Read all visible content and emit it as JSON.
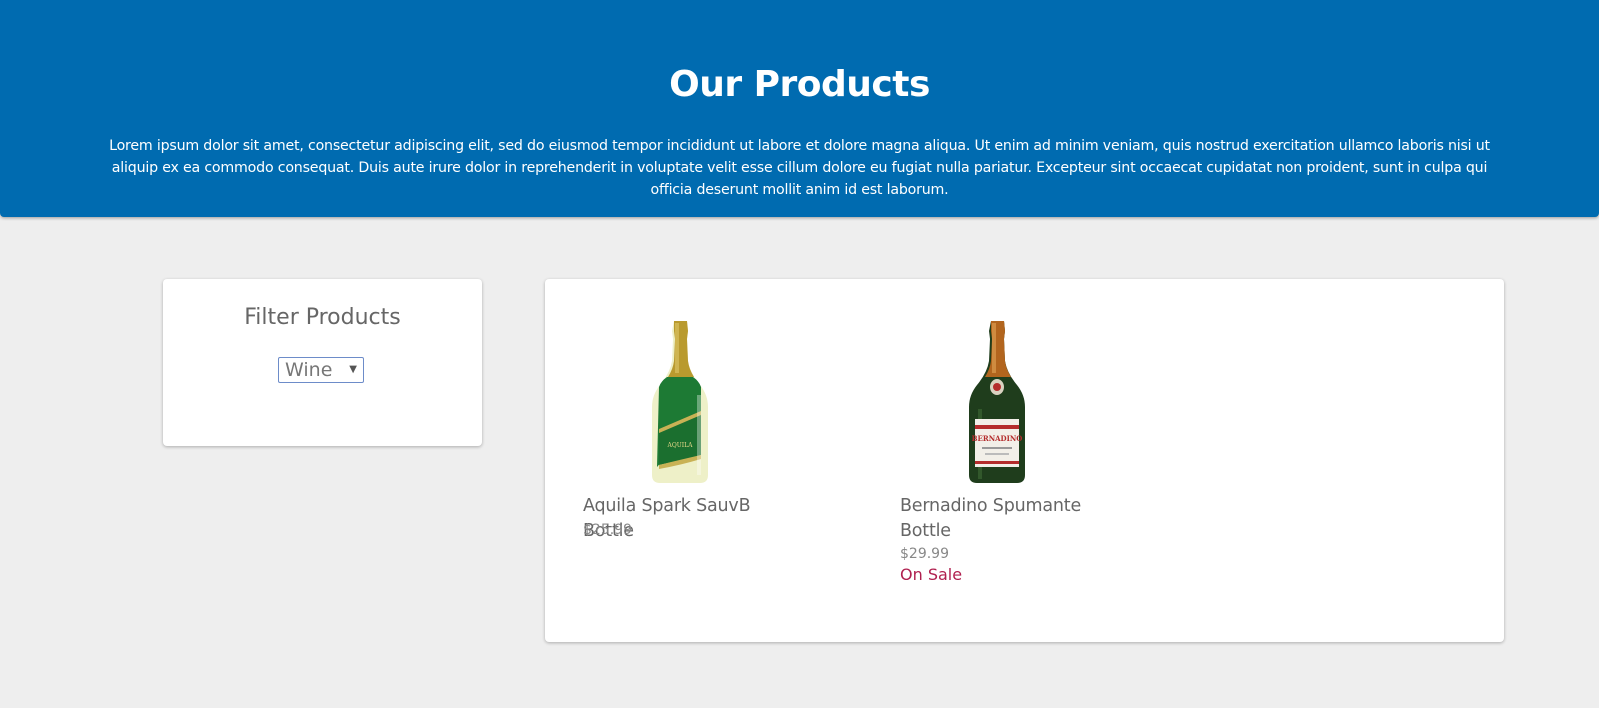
{
  "header": {
    "title": "Our Products",
    "description": "Lorem ipsum dolor sit amet, consectetur adipiscing elit, sed do eiusmod tempor incididunt ut labore et dolore magna aliqua. Ut enim ad minim veniam, quis nostrud exercitation ullamco laboris nisi ut aliquip ex ea commodo consequat. Duis aute irure dolor in reprehenderit in voluptate velit esse cillum dolore eu fugiat nulla pariatur. Excepteur sint occaecat cupidatat non proident, sunt in culpa qui officia deserunt mollit anim id est laborum."
  },
  "filter": {
    "title": "Filter Products",
    "selected": "Wine",
    "caret": "▼"
  },
  "products": [
    {
      "name": "Aquila Spark SauvB Bottle",
      "price": "$25.99",
      "on_sale": "",
      "image_icon": "wine-bottle-aquila-icon"
    },
    {
      "name": "Bernadino Spumante Bottle",
      "price": "$29.99",
      "on_sale": "On Sale",
      "image_icon": "wine-bottle-bernadino-icon"
    }
  ],
  "colors": {
    "header_bg": "#006bb0",
    "page_bg": "#eeeeee",
    "sale": "#b0204f",
    "select_border": "#6d8cc9"
  }
}
